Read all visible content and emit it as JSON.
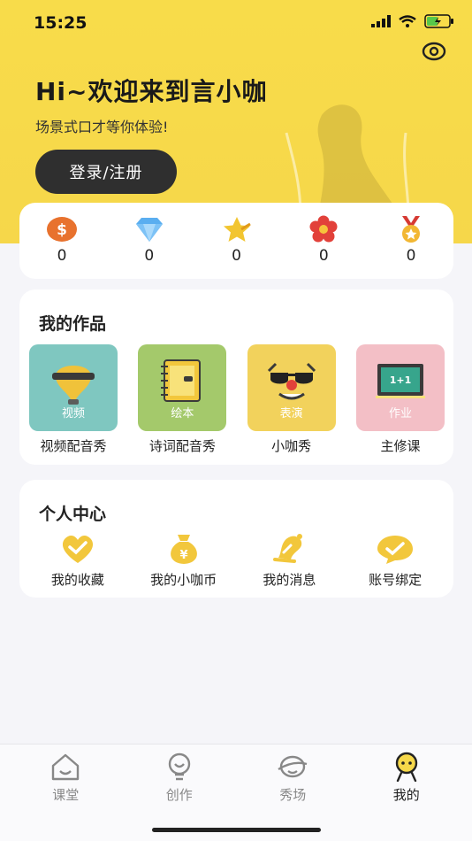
{
  "status": {
    "time": "15:25"
  },
  "header": {
    "greeting": "Hi~欢迎来到言小咖",
    "subtitle": "场景式口才等你体验!",
    "login_label": "登录/注册"
  },
  "stats": [
    {
      "icon": "coin-icon",
      "value": "0"
    },
    {
      "icon": "diamond-icon",
      "value": "0"
    },
    {
      "icon": "star-icon",
      "value": "0"
    },
    {
      "icon": "flower-icon",
      "value": "0"
    },
    {
      "icon": "medal-icon",
      "value": "0"
    }
  ],
  "works": {
    "title": "我的作品",
    "items": [
      {
        "tile_label": "视频",
        "name": "视频配音秀",
        "color": "#7fc7c0"
      },
      {
        "tile_label": "绘本",
        "name": "诗词配音秀",
        "color": "#a4c96b"
      },
      {
        "tile_label": "表演",
        "name": "小咖秀",
        "color": "#f2d25c"
      },
      {
        "tile_label": "作业",
        "name": "主修课",
        "color": "#f3bfc6"
      }
    ]
  },
  "center": {
    "title": "个人中心",
    "items": [
      {
        "icon": "heart-check-icon",
        "label": "我的收藏"
      },
      {
        "icon": "money-bag-icon",
        "label": "我的小咖币"
      },
      {
        "icon": "bell-icon",
        "label": "我的消息"
      },
      {
        "icon": "chat-check-icon",
        "label": "账号绑定"
      }
    ]
  },
  "tabs": [
    {
      "label": "课堂",
      "icon": "house-icon"
    },
    {
      "label": "创作",
      "icon": "bulb-icon"
    },
    {
      "label": "秀场",
      "icon": "planet-icon"
    },
    {
      "label": "我的",
      "icon": "face-icon",
      "active": true
    }
  ],
  "colors": {
    "accent": "#f8dc4a",
    "dark_button": "#2f2f2f"
  }
}
